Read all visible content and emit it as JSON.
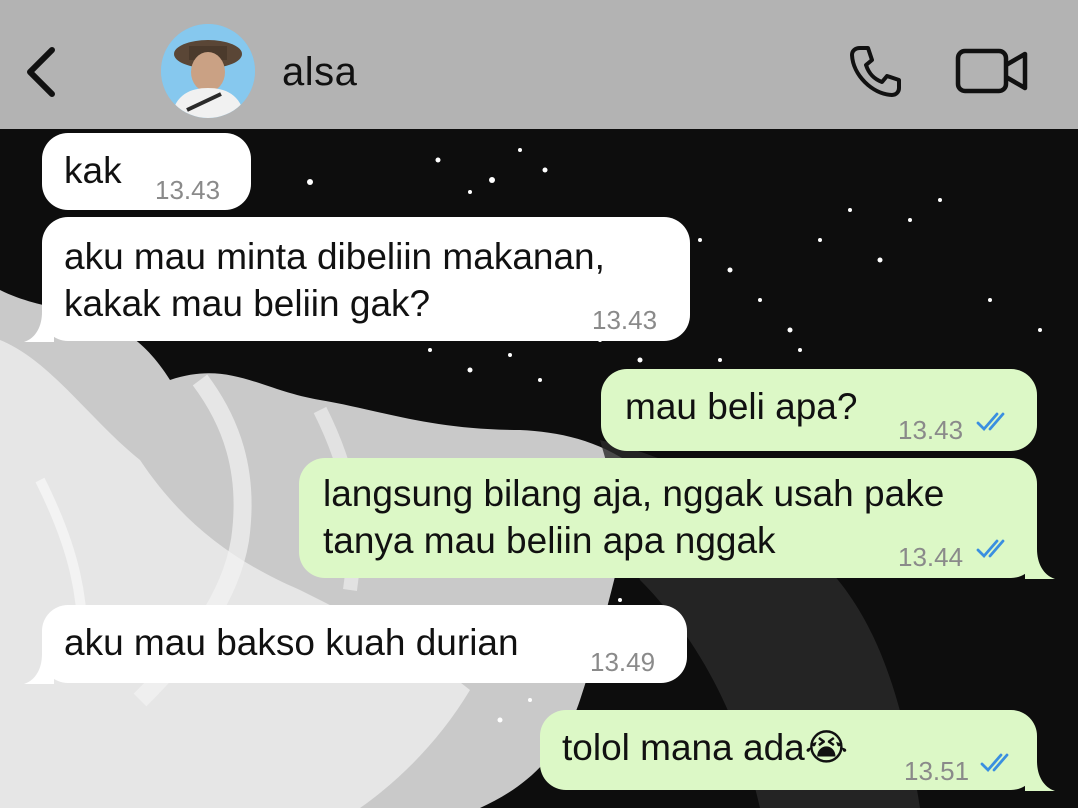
{
  "header": {
    "contact_name": "alsa",
    "back_icon": "chevron-left-icon",
    "call_icon": "phone-icon",
    "video_icon": "video-camera-icon"
  },
  "messages": [
    {
      "direction": "in",
      "text": "kak",
      "time": "13.43"
    },
    {
      "direction": "in",
      "text": "aku mau minta dibeliin makanan,\nkakak mau beliin gak?",
      "time": "13.43"
    },
    {
      "direction": "out",
      "text": "mau beli apa?",
      "time": "13.43",
      "status": "read"
    },
    {
      "direction": "out",
      "text": "langsung bilang aja, nggak usah pake\ntanya mau beliin apa nggak",
      "time": "13.44",
      "status": "read"
    },
    {
      "direction": "in",
      "text": "aku mau bakso kuah durian",
      "time": "13.49"
    },
    {
      "direction": "out",
      "text": "tolol mana ada😭",
      "time": "13.51",
      "status": "read"
    }
  ],
  "colors": {
    "header_bg": "#b3b3b3",
    "incoming_bubble": "#ffffff",
    "outgoing_bubble": "#dcf8c6",
    "read_ticks": "#3a8fe0",
    "timestamp": "#8a8a8a"
  }
}
